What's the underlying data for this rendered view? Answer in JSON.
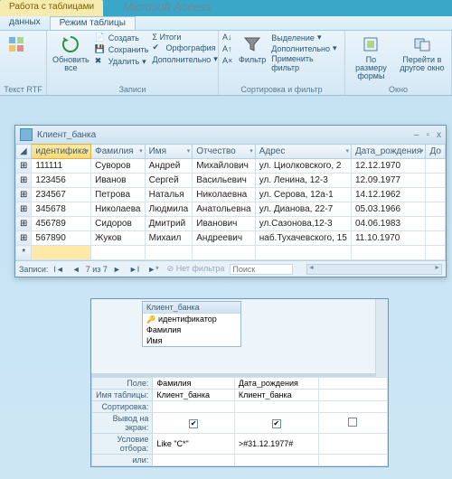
{
  "tabs": {
    "context": "Работа с таблицами",
    "apptitle": "Microsoft Access"
  },
  "subtabs": {
    "left": "данных",
    "active": "Режим таблицы"
  },
  "ribbon": {
    "g1": {
      "label": "Текст RTF"
    },
    "g2": {
      "big": "Обновить\nвсе",
      "small1": "Создать",
      "small2": "Сохранить",
      "small3": "Удалить",
      "sum": "Σ Итоги",
      "spell": "Орфография",
      "more": "Дополнительно",
      "label": "Записи"
    },
    "g3": {
      "big": "Фильтр",
      "s1": "Выделение",
      "s2": "Дополнительно",
      "s3": "Применить фильтр",
      "label": "Сортировка и фильтр"
    },
    "g4": {
      "b1": "По размеру\nформы",
      "b2": "Перейти в\nдругое окно",
      "label": "Окно"
    }
  },
  "window": {
    "title": "Клиент_банка",
    "columns": [
      "идентифика",
      "Фамилия",
      "Имя",
      "Отчество",
      "Адрес",
      "Дата_рождения",
      "До"
    ],
    "rows": [
      [
        "111111",
        "Суворов",
        "Андрей",
        "Михайлович",
        "ул. Циолковского, 2",
        "12.12.1970"
      ],
      [
        "123456",
        "Иванов",
        "Сергей",
        "Васильевич",
        "ул. Ленина, 12-3",
        "12.09.1977"
      ],
      [
        "234567",
        "Петрова",
        "Наталья",
        "Николаевна",
        "ул. Серова, 12а-1",
        "14.12.1962"
      ],
      [
        "345678",
        "Николаева",
        "Людмила",
        "Анатольевна",
        "ул. Дианова, 22-7",
        "05.03.1966"
      ],
      [
        "456789",
        "Сидоров",
        "Дмитрий",
        "Иванович",
        "ул.Сазонова,12-3",
        "04.06.1983"
      ],
      [
        "567890",
        "Жуков",
        "Михаил",
        "Андреевич",
        "наб.Тухачевского, 15",
        "11.10.1970"
      ]
    ],
    "nav": {
      "label": "Записи:",
      "pos": "7 из 7",
      "nofilter": "Нет фильтра",
      "search": "Поиск"
    }
  },
  "qdesign": {
    "box": {
      "title": "Клиент_банка",
      "pk": "идентификатор",
      "f1": "Фамилия",
      "f2": "Имя"
    },
    "rows": {
      "r1": "Поле:",
      "r2": "Имя таблицы:",
      "r3": "Сортировка:",
      "r4": "Вывод на экран:",
      "r5": "Условие отбора:",
      "r6": "или:"
    },
    "c1": {
      "field": "Фамилия",
      "table": "Клиент_банка",
      "crit": "Like \"С*\""
    },
    "c2": {
      "field": "Дата_рождения",
      "table": "Клиент_банка",
      "crit": ">#31.12.1977#"
    }
  }
}
